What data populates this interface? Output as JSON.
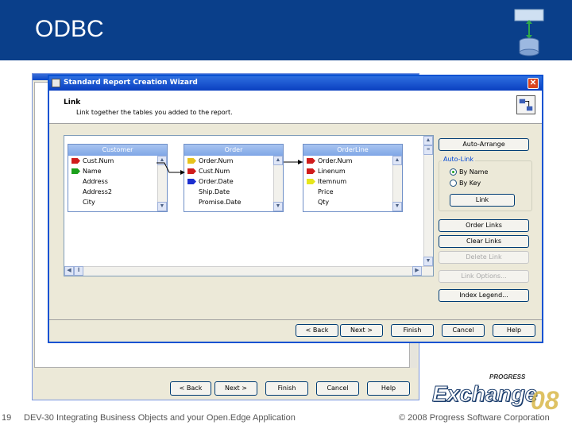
{
  "slide": {
    "title": "ODBC",
    "page_number": "19",
    "footer_title": "DEV-30 Integrating Business Objects and your Open.Edge Application",
    "copyright": "© 2008 Progress Software Corporation",
    "header_color": "#0a3f8a"
  },
  "background_window": {
    "buttons": [
      "< Back",
      "Next >",
      "Finish",
      "Cancel",
      "Help"
    ]
  },
  "wizard": {
    "title": "Standard Report Creation Wizard",
    "step_title": "Link",
    "step_description": "Link together the tables you added to the report.",
    "tables": [
      {
        "name": "Customer",
        "fields": [
          {
            "name": "Cust.Num",
            "key_color": "#d01c1c"
          },
          {
            "name": "Name",
            "key_color": "#1ca01c"
          },
          {
            "name": "Address",
            "key_color": ""
          },
          {
            "name": "Address2",
            "key_color": ""
          },
          {
            "name": "City",
            "key_color": ""
          }
        ]
      },
      {
        "name": "Order",
        "fields": [
          {
            "name": "Order.Num",
            "key_color": "#e6c31c"
          },
          {
            "name": "Cust.Num",
            "key_color": "#d01c1c"
          },
          {
            "name": "Order.Date",
            "key_color": "#1c2ed0"
          },
          {
            "name": "Ship.Date",
            "key_color": ""
          },
          {
            "name": "Promise.Date",
            "key_color": ""
          }
        ]
      },
      {
        "name": "OrderLine",
        "fields": [
          {
            "name": "Order.Num",
            "key_color": "#d01c1c"
          },
          {
            "name": "Linenum",
            "key_color": "#d01c1c"
          },
          {
            "name": "Itemnum",
            "key_color": "#e6e61c"
          },
          {
            "name": "Price",
            "key_color": ""
          },
          {
            "name": "Qty",
            "key_color": ""
          }
        ]
      }
    ],
    "auto_arrange_label": "Auto-Arrange",
    "auto_link": {
      "label": "Auto-Link",
      "options": [
        "By Name",
        "By Key"
      ],
      "selected": "By Name",
      "link_button": "Link"
    },
    "side_buttons": [
      {
        "label": "Order Links",
        "enabled": true
      },
      {
        "label": "Clear Links",
        "enabled": true
      },
      {
        "label": "Delete Link",
        "enabled": false
      },
      {
        "label": "Link Options...",
        "enabled": false
      },
      {
        "label": "Index Legend...",
        "enabled": true
      }
    ],
    "nav_buttons": [
      "< Back",
      "Next >",
      "Finish",
      "Cancel",
      "Help"
    ]
  },
  "logo": {
    "brand": "PROGRESS",
    "product": "Exchange",
    "year": "08"
  }
}
